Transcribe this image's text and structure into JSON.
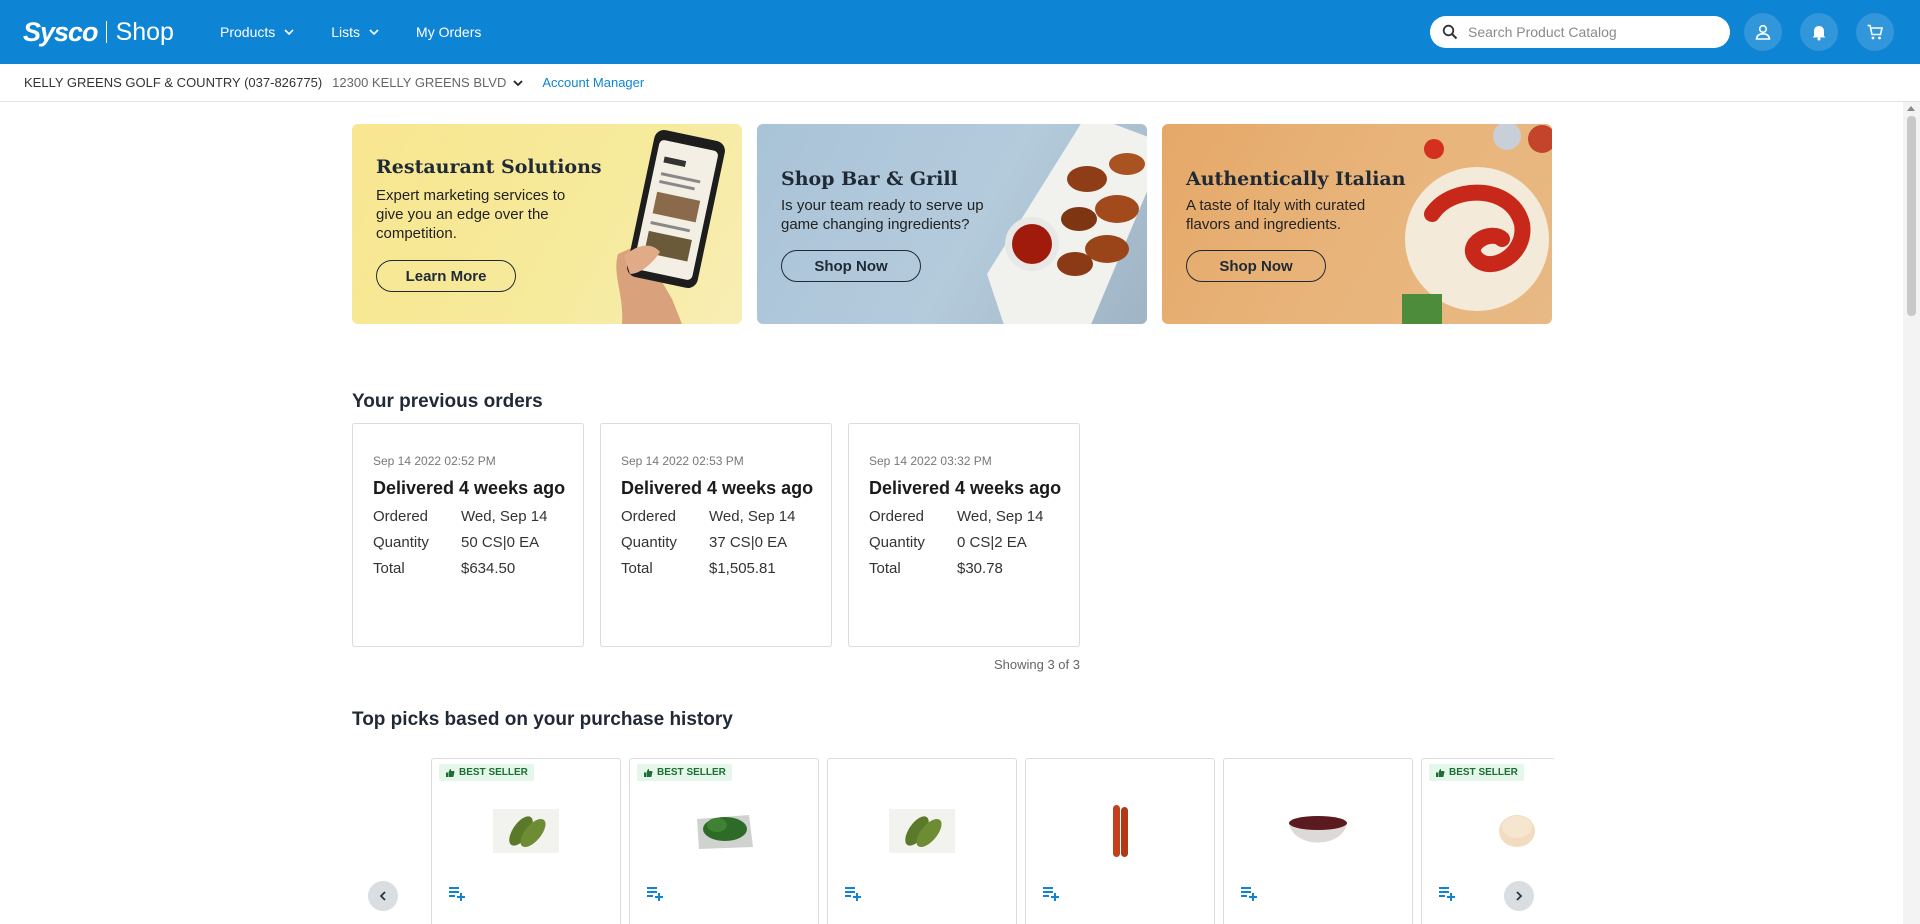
{
  "header": {
    "brand": "Sysco",
    "shop": "Shop",
    "nav": [
      {
        "label": "Products"
      },
      {
        "label": "Lists"
      },
      {
        "label": "My Orders"
      }
    ],
    "search_placeholder": "Search Product Catalog"
  },
  "account": {
    "name": "KELLY GREENS GOLF & COUNTRY (037-826775)",
    "address": "12300 KELLY GREENS BLVD",
    "manager_link": "Account Manager"
  },
  "banners": [
    {
      "title": "Restaurant Solutions",
      "desc": "Expert marketing services to give you an edge over the competition.",
      "button": "Learn More"
    },
    {
      "title": "Shop Bar & Grill",
      "desc": "Is your team ready to serve up game changing ingredients?",
      "button": "Shop Now"
    },
    {
      "title": "Authentically Italian",
      "desc": "A taste of Italy with curated flavors and ingredients.",
      "button": "Shop Now"
    }
  ],
  "orders_section": {
    "title": "Your previous orders",
    "labels": {
      "ordered": "Ordered",
      "quantity": "Quantity",
      "total": "Total"
    },
    "orders": [
      {
        "date": "Sep 14 2022 02:52 PM",
        "status": "Delivered 4 weeks ago",
        "ordered": "Wed, Sep 14",
        "quantity": "50 CS|0 EA",
        "total": "$634.50"
      },
      {
        "date": "Sep 14 2022 02:53 PM",
        "status": "Delivered 4 weeks ago",
        "ordered": "Wed, Sep 14",
        "quantity": "37 CS|0 EA",
        "total": "$1,505.81"
      },
      {
        "date": "Sep 14 2022 03:32 PM",
        "status": "Delivered 4 weeks ago",
        "ordered": "Wed, Sep 14",
        "quantity": "0 CS|2 EA",
        "total": "$30.78"
      }
    ],
    "showing": "Showing 3 of 3"
  },
  "picks_section": {
    "title": "Top picks based on your purchase history",
    "badge_label": "BEST SELLER",
    "products": [
      {
        "badge": true,
        "image": "pickles"
      },
      {
        "badge": true,
        "image": "greens-bag"
      },
      {
        "badge": false,
        "image": "pickles"
      },
      {
        "badge": false,
        "image": "sausages"
      },
      {
        "badge": false,
        "image": "sauce-bowl"
      },
      {
        "badge": true,
        "image": "bun"
      }
    ]
  },
  "colors": {
    "header_bg": "#0e84d4",
    "link": "#0e84d4",
    "badge_bg": "#e5f6ea",
    "badge_text": "#1d6e34"
  }
}
